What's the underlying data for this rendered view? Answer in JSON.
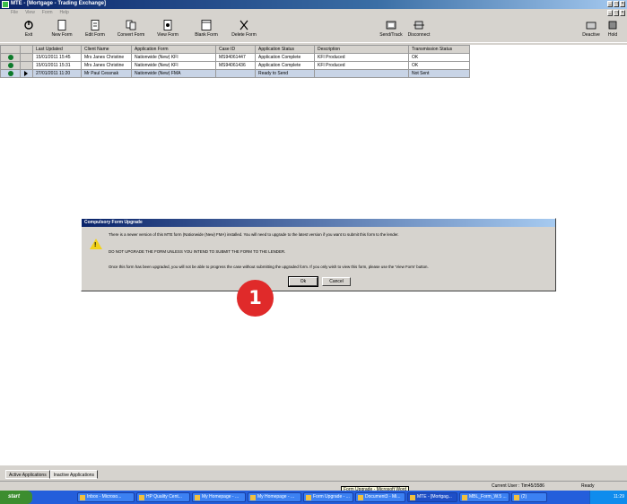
{
  "window": {
    "title": "MTE - [Mortgage - Trading Exchange]"
  },
  "menu": {
    "items": [
      "File",
      "View",
      "Form",
      "Help"
    ]
  },
  "toolbar": {
    "exit": "Exit",
    "new_form": "New Form",
    "edit_form": "Edit Form",
    "convert_form": "Convert Form",
    "view_form": "View Form",
    "blank_form": "Blank Form",
    "delete_form": "Delete Form",
    "send_track": "Send/Track",
    "disconnect": "Disconnect",
    "deactivate": "Deactive",
    "hold": "Hold"
  },
  "grid": {
    "columns": [
      "Last Updated",
      "Client Name",
      "Application Form",
      "Case ID",
      "Application Status",
      "Description",
      "Transmission Status"
    ],
    "rows": [
      [
        "15/01/2011 15:45",
        "Mrs Janes Christine",
        "Nationwide (New) KFI",
        "MS94061447",
        "Application Complete",
        "KFI Produced",
        "OK"
      ],
      [
        "15/01/2011 15:31",
        "Mrs Janes Christine",
        "Nationwide (New) KFI",
        "MS94061436",
        "Application Complete",
        "KFI Produced",
        "OK"
      ],
      [
        "27/01/2011 11:20",
        "Mr Paul Cessnak",
        "Nationwide (New) FMA",
        "",
        "Ready to Send",
        "",
        "Not Sent"
      ]
    ]
  },
  "tabs": {
    "active": "Active Applications",
    "inactive": "Inactive Applications"
  },
  "status": {
    "user": "Current User : Tim45/3586",
    "state": "Ready"
  },
  "dialog": {
    "title": "Compulsory Form Upgrade",
    "line1": "There is a newer version of this MTE form (Nationwide (New) FMA) installed. You will need to upgrade to the latest version if you want to submit this form to the lender.",
    "line2": "DO NOT UPGRADE THE FORM UNLESS YOU INTEND TO SUBMIT THE FORM TO THE LENDER.",
    "line3": "Once this form has been upgraded, you will not be able to progress the case without submitting the upgraded form. If you only wish to view this form, please use the 'View Form' button.",
    "ok": "Ok",
    "cancel": "Cancel"
  },
  "marker": "1",
  "taskbar": {
    "start": "start",
    "items": [
      "Inbox - Microso...",
      "HP Quality Cent...",
      "My Homepage - ...",
      "My Homepage - ...",
      "Form Upgrade - ...",
      "Document3 - Mi...",
      "MTE - [Mortgag...",
      "MBL_Form_W.5 ...",
      "Form Upgrade - ...",
      "MTE - [Mortgag...",
      "(2)"
    ],
    "tooltip": "Form Upgrade - Microsoft Word",
    "clock": "11:29"
  }
}
